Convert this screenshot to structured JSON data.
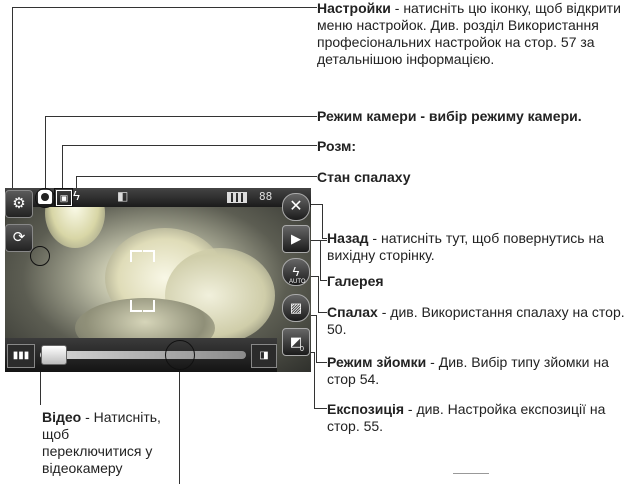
{
  "annotations": {
    "settings": {
      "title": "Настройки",
      "text": " - натисніть цю іконку, щоб відкрити меню настройок. Див. розділ Використання професіональних настройок на стор. 57 за детальнішою інформацією."
    },
    "camera_mode": {
      "title": "Режим камери - вибір режиму камери."
    },
    "size": {
      "title": "Розм:"
    },
    "flash_status": {
      "title": "Стан спалаху"
    },
    "back": {
      "title": "Назад",
      "text": " - натисніть тут, щоб повернутись на вихідну сторінку."
    },
    "gallery": {
      "title": "Галерея"
    },
    "flash": {
      "title": "Спалах",
      "text": " - див. Використання спалаху на стор. 50."
    },
    "shot_mode": {
      "title": "Режим зйомки",
      "text": " - Див. Вибір типу зйомки на стор 54."
    },
    "exposure": {
      "title": "Експозиція",
      "text": " - див. Настройка експозиції на стор. 55."
    },
    "video": {
      "title": "Відео",
      "text": " - Натисніть, щоб переключитися у відеокамеру"
    }
  },
  "screen": {
    "memory_count": "88",
    "flash_auto": "AUTO",
    "exposure_value": "0"
  },
  "icons": [
    "gear-icon",
    "video-switch-icon",
    "close-icon",
    "play-icon",
    "flash-auto-icon",
    "image-icon",
    "exposure-icon",
    "battery-icon",
    "zoom-icon"
  ]
}
